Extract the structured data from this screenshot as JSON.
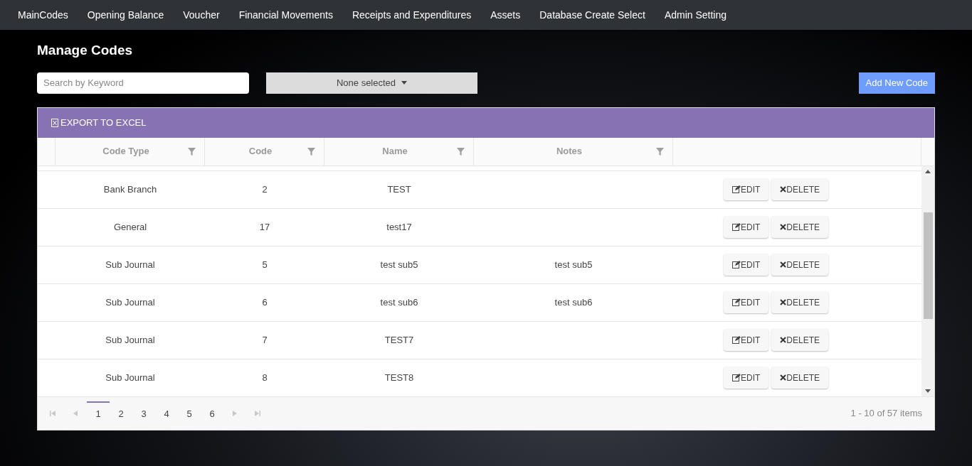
{
  "nav": {
    "items": [
      "MainCodes",
      "Opening Balance",
      "Voucher",
      "Financial Movements",
      "Receipts and Expenditures",
      "Assets",
      "Database Create Select",
      "Admin Setting"
    ]
  },
  "page_title": "Manage Codes",
  "search": {
    "placeholder": "Search by Keyword"
  },
  "filter_dropdown": {
    "value": "None selected"
  },
  "add_button": "Add New Code",
  "toolbar": {
    "export_button": "EXPORT TO EXCEL"
  },
  "table": {
    "columns": [
      "Code Type",
      "Code",
      "Name",
      "Notes"
    ],
    "rows": [
      {
        "code_type": "Bank Branch",
        "code": "2",
        "name": "TEST",
        "notes": "",
        "edit_label": "EDIT",
        "delete_label": "DELETE"
      },
      {
        "code_type": "General",
        "code": "17",
        "name": "test17",
        "notes": "",
        "edit_label": "EDIT",
        "delete_label": "DELETE"
      },
      {
        "code_type": "Sub Journal",
        "code": "5",
        "name": "test sub5",
        "notes": "test sub5",
        "edit_label": "EDIT",
        "delete_label": "DELETE"
      },
      {
        "code_type": "Sub Journal",
        "code": "6",
        "name": "test sub6",
        "notes": "test sub6",
        "edit_label": "EDIT",
        "delete_label": "DELETE"
      },
      {
        "code_type": "Sub Journal",
        "code": "7",
        "name": "TEST7",
        "notes": "",
        "edit_label": "EDIT",
        "delete_label": "DELETE"
      },
      {
        "code_type": "Sub Journal",
        "code": "8",
        "name": "TEST8",
        "notes": "",
        "edit_label": "EDIT",
        "delete_label": "DELETE"
      }
    ]
  },
  "pager": {
    "pages": [
      {
        "label": "1",
        "selected": true
      },
      {
        "label": "2",
        "selected": false
      },
      {
        "label": "3",
        "selected": false
      },
      {
        "label": "4",
        "selected": false
      },
      {
        "label": "5",
        "selected": false
      },
      {
        "label": "6",
        "selected": false
      }
    ],
    "info": "1 - 10 of 57 items"
  }
}
